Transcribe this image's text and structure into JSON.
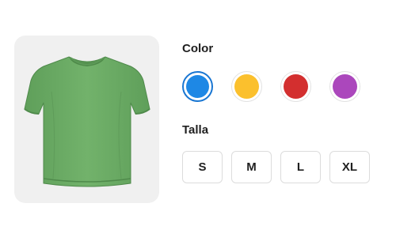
{
  "product": {
    "image_icon": "green-tshirt-icon",
    "shirt_color": "#6aaa64"
  },
  "color_section": {
    "title": "Color",
    "selected_index": 0,
    "selected_ring_color": "#1976d2",
    "swatches": [
      {
        "name": "blue",
        "hex": "#1e88e5"
      },
      {
        "name": "yellow",
        "hex": "#fbc02d"
      },
      {
        "name": "red",
        "hex": "#d32f2f"
      },
      {
        "name": "purple",
        "hex": "#ab47bc"
      }
    ]
  },
  "size_section": {
    "title": "Talla",
    "sizes": [
      "S",
      "M",
      "L",
      "XL"
    ]
  }
}
